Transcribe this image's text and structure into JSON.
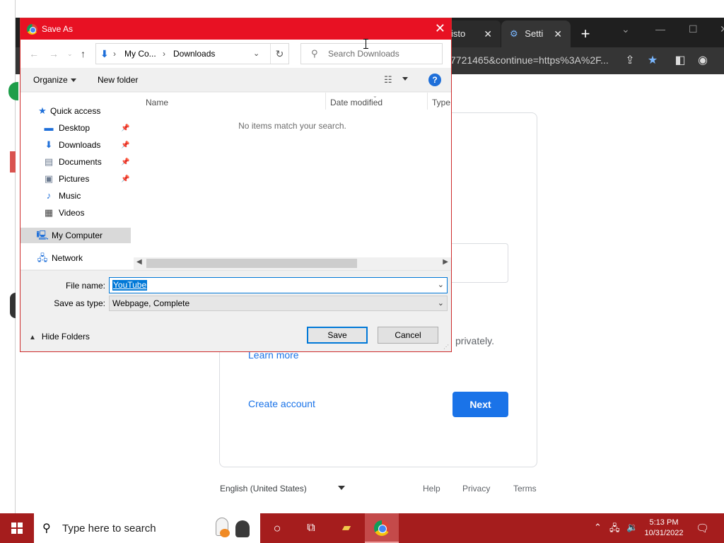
{
  "browser": {
    "tab_prev_label": "isto",
    "tab_settings_label": "Setti",
    "tab_close": "✕",
    "new_tab": "+",
    "address_text": "7721465&continue=https%3A%2F..."
  },
  "signin_page": {
    "privately_text": "privately.",
    "learn_more": "Learn more",
    "create_account": "Create account",
    "next_button": "Next",
    "footer_language": "English (United States)",
    "footer_help": "Help",
    "footer_privacy": "Privacy",
    "footer_terms": "Terms"
  },
  "dialog": {
    "title": "Save As",
    "close": "✕",
    "breadcrumb": [
      "My Co...",
      "Downloads"
    ],
    "search_placeholder": "Search Downloads",
    "toolbar": {
      "organize": "Organize",
      "new_folder": "New folder",
      "help": "?"
    },
    "nav": {
      "quick_access": "Quick access",
      "items": [
        {
          "label": "Desktop",
          "icon": "desktop-icon",
          "pinned": true
        },
        {
          "label": "Downloads",
          "icon": "downloads-icon",
          "pinned": true
        },
        {
          "label": "Documents",
          "icon": "documents-icon",
          "pinned": true
        },
        {
          "label": "Pictures",
          "icon": "pictures-icon",
          "pinned": true
        },
        {
          "label": "Music",
          "icon": "music-icon",
          "pinned": false
        },
        {
          "label": "Videos",
          "icon": "videos-icon",
          "pinned": false
        }
      ],
      "my_computer": "My Computer",
      "network": "Network"
    },
    "columns": [
      "Name",
      "Date modified",
      "Type"
    ],
    "empty_message": "No items match your search.",
    "file_name_label": "File name:",
    "file_name_value": "YouTube",
    "save_as_type_label": "Save as type:",
    "save_as_type_value": "Webpage, Complete",
    "hide_folders": "Hide Folders",
    "save_button": "Save",
    "cancel_button": "Cancel"
  },
  "taskbar": {
    "search_placeholder": "Type here to search",
    "time": "5:13 PM",
    "date": "10/31/2022"
  },
  "colors": {
    "dialog_title_bar": "#e81123",
    "taskbar": "#a51d1d",
    "accent_blue": "#1a73e8",
    "selection_blue": "#0078d7"
  }
}
